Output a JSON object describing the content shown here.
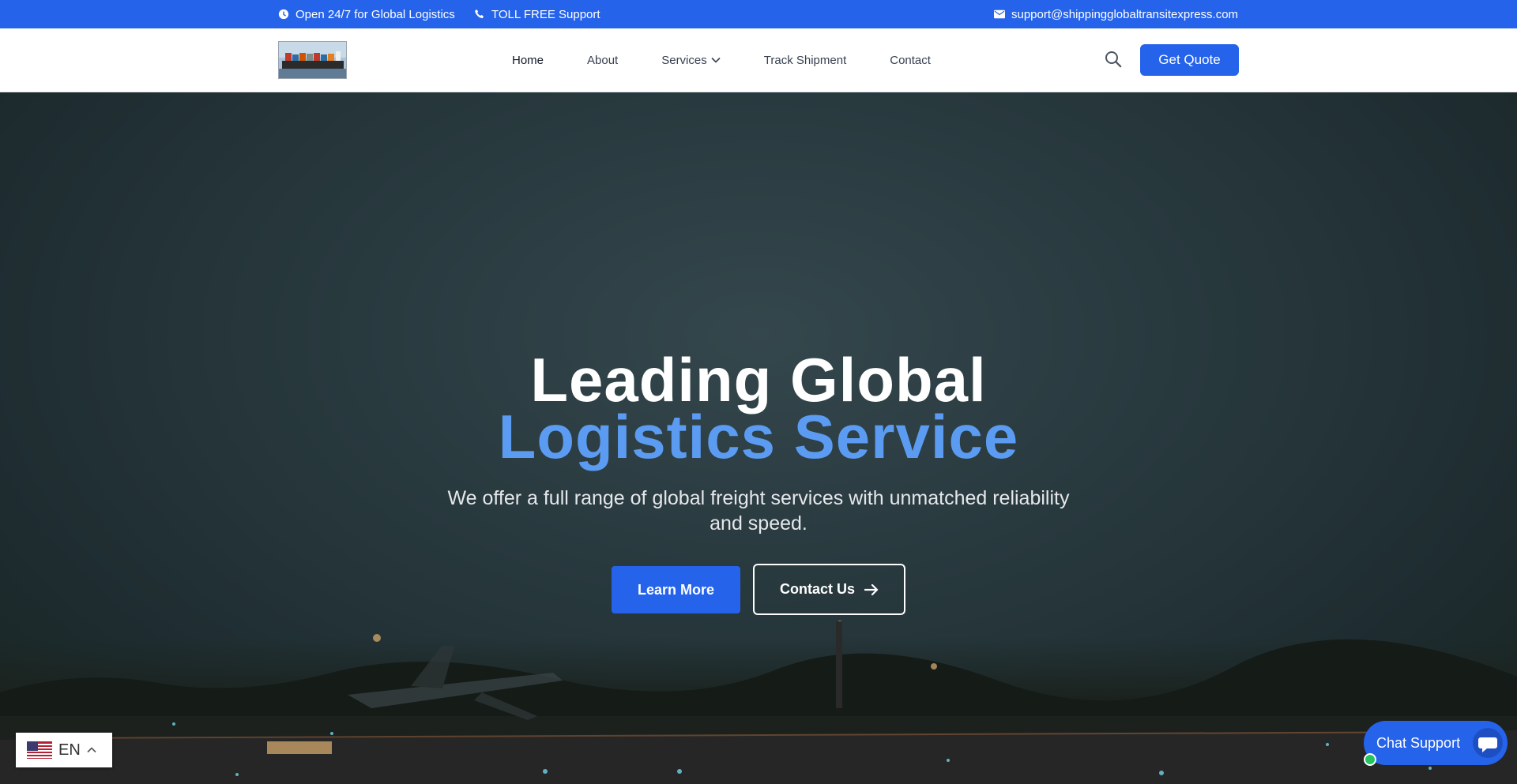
{
  "topbar": {
    "hours": "Open 24/7 for Global Logistics",
    "phone": "TOLL FREE Support",
    "email": "support@shippingglobaltransitexpress.com"
  },
  "nav": {
    "items": [
      {
        "label": "Home"
      },
      {
        "label": "About"
      },
      {
        "label": "Services"
      },
      {
        "label": "Track Shipment"
      },
      {
        "label": "Contact"
      }
    ],
    "quote_label": "Get Quote"
  },
  "hero": {
    "title_line1": "Leading Global",
    "title_line2": "Logistics Service",
    "subtitle": "We offer a full range of global freight services with unmatched reliability and speed.",
    "learn_more": "Learn More",
    "contact_us": "Contact Us"
  },
  "language": {
    "code": "EN"
  },
  "chat": {
    "label": "Chat Support"
  },
  "colors": {
    "accent": "#2563eb",
    "highlight": "#5b9cf2"
  }
}
